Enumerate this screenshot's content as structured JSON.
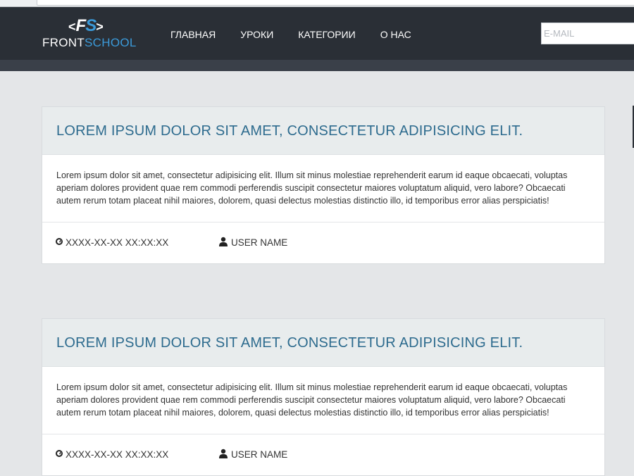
{
  "logo": {
    "brackets_left": "<",
    "mark_f": "F",
    "mark_s": "S",
    "brackets_right": ">",
    "text_front": "FRONT",
    "text_school": "SCHOOL"
  },
  "nav": {
    "items": [
      {
        "label": "ГЛАВНАЯ"
      },
      {
        "label": "УРОКИ"
      },
      {
        "label": "КАТЕГОРИИ"
      },
      {
        "label": "О НАС"
      }
    ]
  },
  "search": {
    "placeholder": "E-MAIL",
    "value": ""
  },
  "colors": {
    "header_bg": "#2a2f36",
    "accent": "#3b9ad9",
    "title": "#2d6b8e",
    "page_bg": "#e4e6e8"
  },
  "posts": [
    {
      "title": "LOREM IPSUM DOLOR SIT AMET, CONSECTETUR ADIPISICING ELIT.",
      "body": "Lorem ipsum dolor sit amet, consectetur adipisicing elit. Illum sit minus molestiae reprehenderit earum id eaque obcaecati, voluptas aperiam dolores provident quae rem commodi perferendis suscipit consectetur maiores voluptatum aliquid, vero labore? Obcaecati autem rerum totam placeat nihil maiores, dolorem, quasi delectus molestias distinctio illo, id temporibus error alias perspiciatis!",
      "date": "XXXX-XX-XX XX:XX:XX",
      "author": "USER NAME"
    },
    {
      "title": "LOREM IPSUM DOLOR SIT AMET, CONSECTETUR ADIPISICING ELIT.",
      "body": "Lorem ipsum dolor sit amet, consectetur adipisicing elit. Illum sit minus molestiae reprehenderit earum id eaque obcaecati, voluptas aperiam dolores provident quae rem commodi perferendis suscipit consectetur maiores voluptatum aliquid, vero labore? Obcaecati autem rerum totam placeat nihil maiores, dolorem, quasi delectus molestias distinctio illo, id temporibus error alias perspiciatis!",
      "date": "XXXX-XX-XX XX:XX:XX",
      "author": "USER NAME"
    }
  ]
}
